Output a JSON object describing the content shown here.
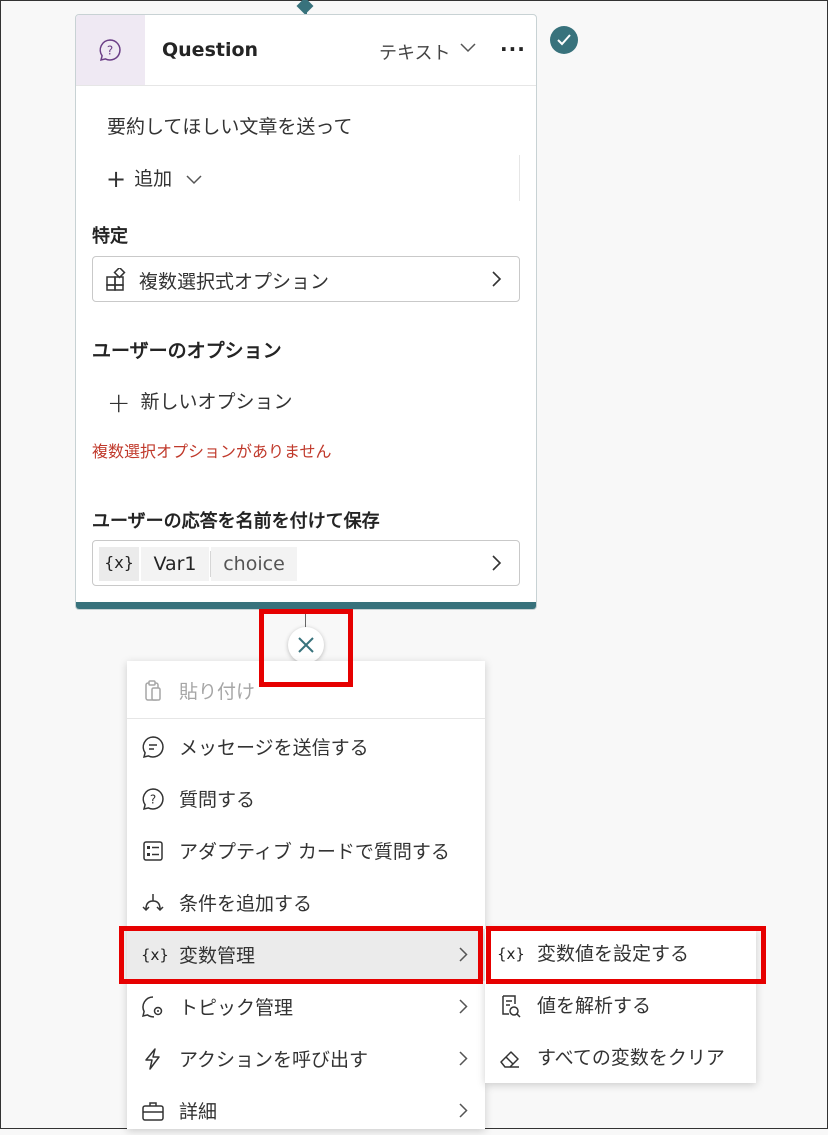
{
  "node": {
    "title": "Question",
    "type_label": "テキスト",
    "more_label": "···",
    "message": "要約してほしい文章を送って",
    "add_label": "追加",
    "identify_label": "特定",
    "identify_value": "複数選択式オプション",
    "user_options_label": "ユーザーのオプション",
    "new_option_label": "新しいオプション",
    "error_text": "複数選択オプションがありません",
    "save_label": "ユーザーの応答を名前を付けて保存",
    "var_icon": "{x}",
    "var_name": "Var1",
    "var_type": "choice"
  },
  "menu": {
    "items": [
      {
        "label": "貼り付け",
        "icon": "clipboard-icon",
        "disabled": true
      },
      {
        "label": "メッセージを送信する",
        "icon": "chat-icon"
      },
      {
        "label": "質問する",
        "icon": "question-icon"
      },
      {
        "label": "アダプティブ カードで質問する",
        "icon": "card-icon"
      },
      {
        "label": "条件を追加する",
        "icon": "branch-icon"
      },
      {
        "label": "変数管理",
        "icon": "variable-icon",
        "submenu": true,
        "active": true
      },
      {
        "label": "トピック管理",
        "icon": "topic-settings-icon",
        "submenu": true
      },
      {
        "label": "アクションを呼び出す",
        "icon": "lightning-icon",
        "submenu": true
      },
      {
        "label": "詳細",
        "icon": "briefcase-icon",
        "submenu": true
      }
    ]
  },
  "submenu": {
    "items": [
      {
        "label": "変数値を設定する",
        "icon": "variable-icon"
      },
      {
        "label": "値を解析する",
        "icon": "parse-value-icon"
      },
      {
        "label": "すべての変数をクリア",
        "icon": "eraser-icon"
      }
    ]
  },
  "colors": {
    "accent": "#38727c",
    "highlight": "#e60000",
    "error": "#c0392b"
  }
}
